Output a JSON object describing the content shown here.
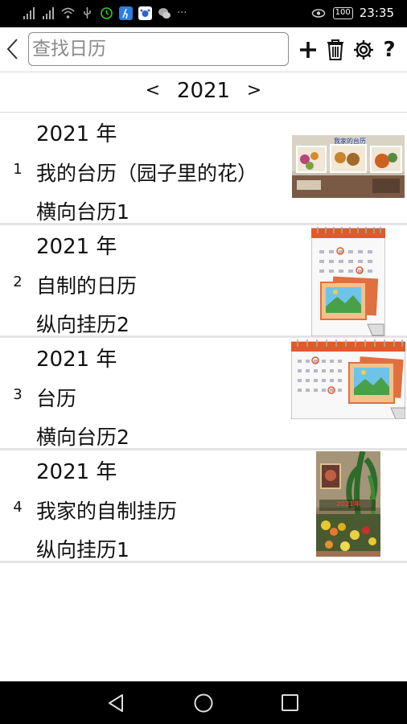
{
  "status_bar": {
    "battery": "100",
    "time": "23:35",
    "extra": "···"
  },
  "toolbar": {
    "search_placeholder": "查找日历",
    "help_label": "?"
  },
  "year_nav": {
    "prev": "<",
    "year": "2021",
    "next": ">"
  },
  "calendars": [
    {
      "index": "1",
      "year": "2021 年",
      "name": "我的台历（园子里的花）",
      "type": "横向台历1"
    },
    {
      "index": "2",
      "year": "2021 年",
      "name": "自制的日历",
      "type": "纵向挂历2"
    },
    {
      "index": "3",
      "year": "2021 年",
      "name": "台历",
      "type": "横向台历2"
    },
    {
      "index": "4",
      "year": "2021 年",
      "name": "我家的自制挂历",
      "type": "纵向挂历1"
    }
  ],
  "thumb_text": {
    "photo_title": "我家的台历",
    "poster_year": "2021年"
  },
  "colors": {
    "calendar_ring": "#e05a2b",
    "grid": "#9a9a9a"
  }
}
